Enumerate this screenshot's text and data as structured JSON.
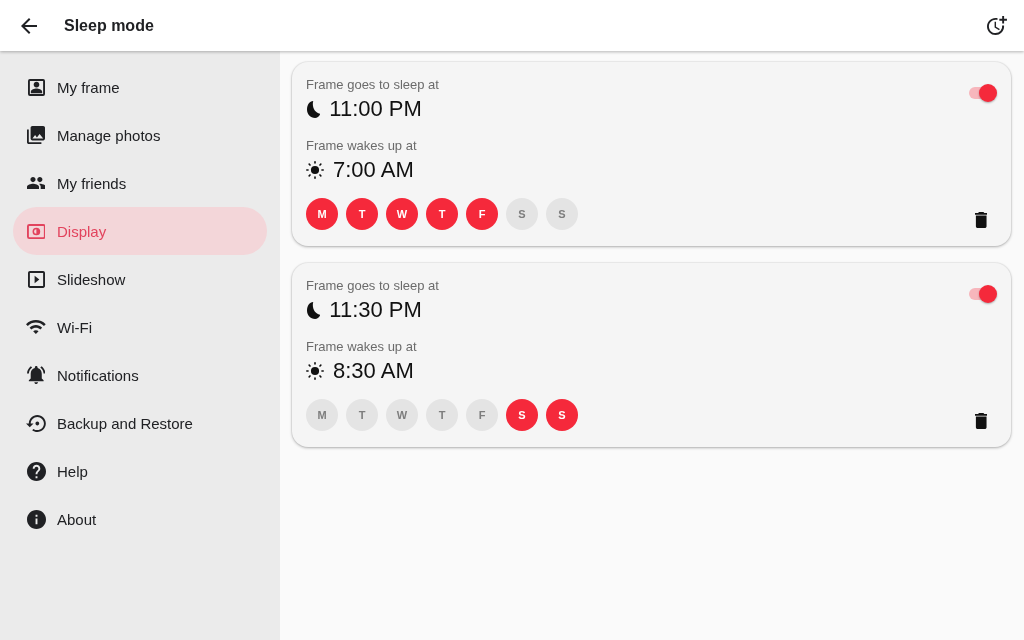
{
  "app_bar": {
    "title": "Sleep mode"
  },
  "sidebar": {
    "items": [
      {
        "label": "My frame",
        "selected": false
      },
      {
        "label": "Manage photos",
        "selected": false
      },
      {
        "label": "My friends",
        "selected": false
      },
      {
        "label": "Display",
        "selected": true
      },
      {
        "label": "Slideshow",
        "selected": false
      },
      {
        "label": "Wi-Fi",
        "selected": false
      },
      {
        "label": "Notifications",
        "selected": false
      },
      {
        "label": "Backup and Restore",
        "selected": false
      },
      {
        "label": "Help",
        "selected": false
      },
      {
        "label": "About",
        "selected": false
      }
    ]
  },
  "schedules": [
    {
      "sleep_label": "Frame goes to sleep at",
      "sleep_time": "11:00 PM",
      "wake_label": "Frame wakes up at",
      "wake_time": "7:00 AM",
      "on": true,
      "days": [
        {
          "label": "M",
          "selected": true
        },
        {
          "label": "T",
          "selected": true
        },
        {
          "label": "W",
          "selected": true
        },
        {
          "label": "T",
          "selected": true
        },
        {
          "label": "F",
          "selected": true
        },
        {
          "label": "S",
          "selected": false
        },
        {
          "label": "S",
          "selected": false
        }
      ]
    },
    {
      "sleep_label": "Frame goes to sleep at",
      "sleep_time": "11:30 PM",
      "wake_label": "Frame wakes up at",
      "wake_time": "8:30 AM",
      "on": true,
      "days": [
        {
          "label": "M",
          "selected": false
        },
        {
          "label": "T",
          "selected": false
        },
        {
          "label": "W",
          "selected": false
        },
        {
          "label": "T",
          "selected": false
        },
        {
          "label": "F",
          "selected": false
        },
        {
          "label": "S",
          "selected": true
        },
        {
          "label": "S",
          "selected": true
        }
      ]
    }
  ]
}
